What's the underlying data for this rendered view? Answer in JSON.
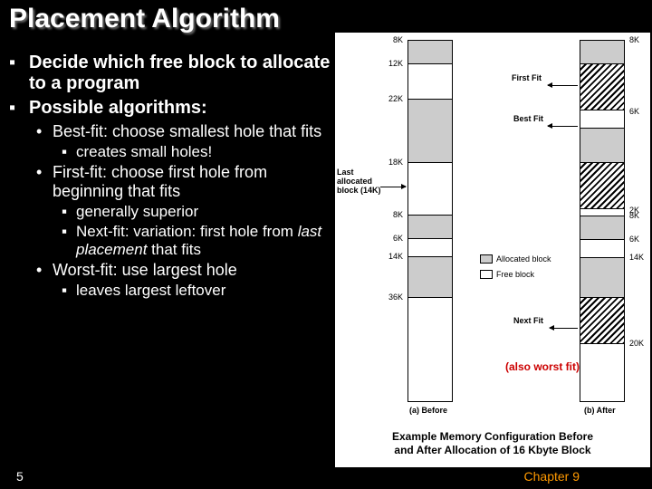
{
  "title": "Placement Algorithm",
  "bullets": {
    "b1a": "Decide which free block to allocate to a program",
    "b1b": "Possible algorithms:",
    "b2a_pre": "Best-fit",
    "b2a_post": ": choose smallest hole that fits",
    "b3a": "creates small holes!",
    "b2b_pre": "First-fit",
    "b2b_post": ": choose first hole from beginning that fits",
    "b3b": "generally superior",
    "b3c_pre": "Next-fit",
    "b3c_mid": ": variation: first hole from ",
    "b3c_em": "last placement",
    "b3c_post": " that fits",
    "b2c_pre": "Worst-fit",
    "b2c_post": ": use largest hole",
    "b3d": "leaves largest leftover"
  },
  "diagram": {
    "labelsA": {
      "s0": "8K",
      "s1": "12K",
      "s2": "22K",
      "s3": "18K",
      "s4": "8K",
      "s5": "6K",
      "s6": "14K",
      "s7": "36K"
    },
    "labelsB": {
      "s0": "8K",
      "s1": "6K",
      "s2": "2K",
      "s3": "8K",
      "s4": "6K",
      "s5": "14K",
      "s6": "20K"
    },
    "last_alloc_l1": "Last",
    "last_alloc_l2": "allocated",
    "last_alloc_l3": "block (14K)",
    "firstfit": "First Fit",
    "bestfit": "Best Fit",
    "nextfit": "Next Fit",
    "worstfit": "(also worst fit)",
    "legend_alloc": "Allocated block",
    "legend_free": "Free block",
    "colA": "(a) Before",
    "colB": "(b) After",
    "caption_l1": "Example Memory Configuration Before",
    "caption_l2": "and After Allocation of 16 Kbyte Block"
  },
  "footer": {
    "page": "5",
    "chapter": "Chapter 9"
  }
}
